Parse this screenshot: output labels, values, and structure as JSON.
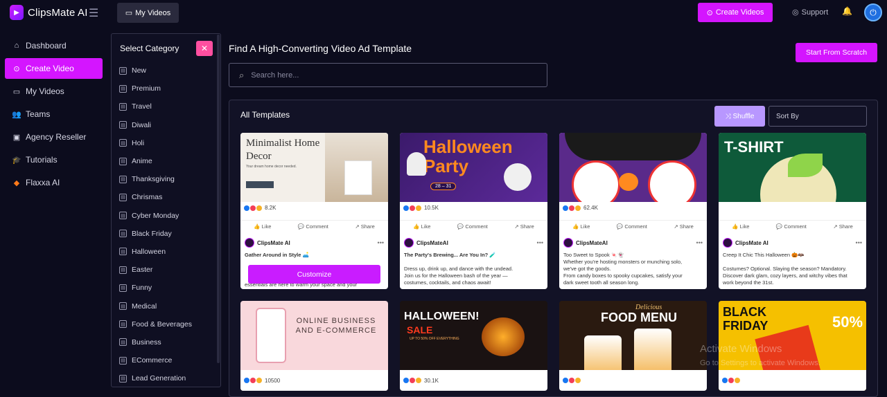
{
  "app": {
    "name": "ClipsMate AI"
  },
  "topbar": {
    "my_videos": "My Videos",
    "create_videos": "Create Videos",
    "support": "Support"
  },
  "sidebar": {
    "items": [
      {
        "label": "Dashboard",
        "icon": "home-icon"
      },
      {
        "label": "Create Video",
        "icon": "play-circle-icon",
        "active": true
      },
      {
        "label": "My Videos",
        "icon": "video-icon"
      },
      {
        "label": "Teams",
        "icon": "users-icon"
      },
      {
        "label": "Agency Reseller",
        "icon": "briefcase-icon"
      },
      {
        "label": "Tutorials",
        "icon": "graduation-cap-icon"
      },
      {
        "label": "Flaxxa AI",
        "icon": "flaxxa-logo-icon"
      }
    ]
  },
  "categories": {
    "header": "Select Category",
    "items": [
      "New",
      "Premium",
      "Travel",
      "Diwali",
      "Holi",
      "Anime",
      "Thanksgiving",
      "Chrismas",
      "Cyber Monday",
      "Black Friday",
      "Halloween",
      "Easter",
      "Funny",
      "Medical",
      "Food & Beverages",
      "Business",
      "ECommerce",
      "Lead Generation"
    ]
  },
  "main": {
    "title": "Find A High-Converting Video Ad Template",
    "start_from_scratch": "Start From Scratch",
    "search_placeholder": "Search here...",
    "section_title": "All Templates",
    "shuffle": "Shuffle",
    "sort_by": "Sort By"
  },
  "cards": [
    {
      "image_title": "Minimalist Home Decor",
      "image_subtitle": "Your dream home decor needed.",
      "reactions": "8.2K",
      "like": "Like",
      "comment": "Comment",
      "share": "Share",
      "author": "ClipsMate AI",
      "text": "Gather Around in Style 🛋️",
      "text2": "essentials are here to warm your space and your",
      "customize": "Customize"
    },
    {
      "image_title": "Halloween Party",
      "image_date": "28 – 31",
      "reactions": "10.5K",
      "like": "Like",
      "comment": "Comment",
      "share": "Share",
      "author": "ClipsMateAI",
      "text": "The Party's Brewing... Are You In? 🧪",
      "text2": "Dress up, drink up, and dance with the undead.",
      "text3": "Join us for the Halloween bash of the year —",
      "text4": "costumes, cocktails, and chaos await!"
    },
    {
      "reactions": "62.4K",
      "like": "Like",
      "comment": "Comment",
      "share": "Share",
      "author": "ClipsMateAI",
      "text": "Too Sweet to Spook 🍬👻",
      "text2": "Whether you're hosting monsters or munching solo,",
      "text3": "we've got the goods.",
      "text4": "From candy boxes to spooky cupcakes, satisfy your",
      "text5": "dark sweet tooth all season long."
    },
    {
      "image_title": "T-SHIRT",
      "like": "Like",
      "comment": "Comment",
      "share": "Share",
      "author": "ClipsMate AI",
      "text": "Creep It Chic This Halloween 🎃🦇",
      "text2": "Costumes? Optional. Slaying the season? Mandatory.",
      "text3": "Discover dark glam, cozy layers, and witchy vibes that",
      "text4": "work beyond the 31st."
    }
  ],
  "bottom_cards": [
    {
      "image_title": "ONLINE BUSINESS AND E-COMMERCE",
      "reactions": "10500"
    },
    {
      "image_title": "HALLOWEEN!",
      "image_sub": "SALE",
      "image_note": "UP TO 50% OFF EVERYTHING",
      "reactions": "30.1K"
    },
    {
      "image_title": "FOOD MENU",
      "image_note": "Delicious"
    },
    {
      "image_title": "BLACK FRIDAY",
      "image_note": "50%"
    }
  ],
  "watermark": {
    "line1": "Activate Windows",
    "line2": "Go to Settings to activate Windows."
  },
  "colors": {
    "accent": "#d415ff",
    "background": "#0c0c1d",
    "close": "#ff4fa0",
    "shuffle": "#b897ff"
  }
}
